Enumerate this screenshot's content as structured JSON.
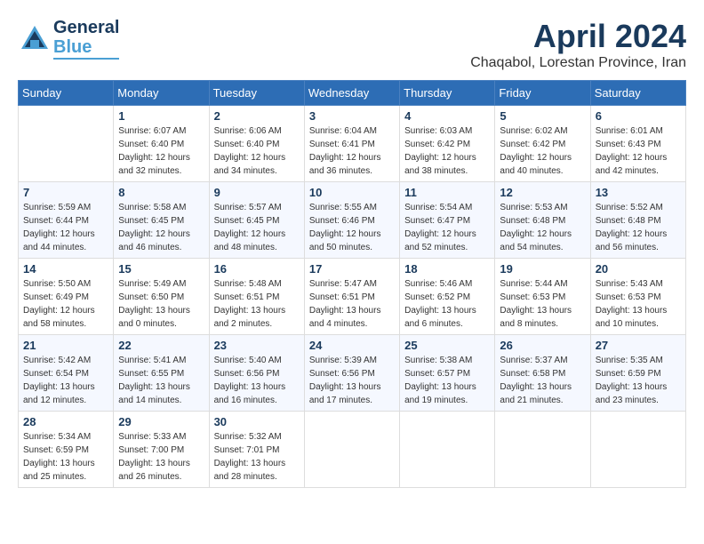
{
  "logo": {
    "line1": "General",
    "line2": "Blue"
  },
  "title": "April 2024",
  "location": "Chaqabol, Lorestan Province, Iran",
  "days_header": [
    "Sunday",
    "Monday",
    "Tuesday",
    "Wednesday",
    "Thursday",
    "Friday",
    "Saturday"
  ],
  "weeks": [
    [
      {
        "num": "",
        "sunrise": "",
        "sunset": "",
        "daylight": ""
      },
      {
        "num": "1",
        "sunrise": "Sunrise: 6:07 AM",
        "sunset": "Sunset: 6:40 PM",
        "daylight": "Daylight: 12 hours and 32 minutes."
      },
      {
        "num": "2",
        "sunrise": "Sunrise: 6:06 AM",
        "sunset": "Sunset: 6:40 PM",
        "daylight": "Daylight: 12 hours and 34 minutes."
      },
      {
        "num": "3",
        "sunrise": "Sunrise: 6:04 AM",
        "sunset": "Sunset: 6:41 PM",
        "daylight": "Daylight: 12 hours and 36 minutes."
      },
      {
        "num": "4",
        "sunrise": "Sunrise: 6:03 AM",
        "sunset": "Sunset: 6:42 PM",
        "daylight": "Daylight: 12 hours and 38 minutes."
      },
      {
        "num": "5",
        "sunrise": "Sunrise: 6:02 AM",
        "sunset": "Sunset: 6:42 PM",
        "daylight": "Daylight: 12 hours and 40 minutes."
      },
      {
        "num": "6",
        "sunrise": "Sunrise: 6:01 AM",
        "sunset": "Sunset: 6:43 PM",
        "daylight": "Daylight: 12 hours and 42 minutes."
      }
    ],
    [
      {
        "num": "7",
        "sunrise": "Sunrise: 5:59 AM",
        "sunset": "Sunset: 6:44 PM",
        "daylight": "Daylight: 12 hours and 44 minutes."
      },
      {
        "num": "8",
        "sunrise": "Sunrise: 5:58 AM",
        "sunset": "Sunset: 6:45 PM",
        "daylight": "Daylight: 12 hours and 46 minutes."
      },
      {
        "num": "9",
        "sunrise": "Sunrise: 5:57 AM",
        "sunset": "Sunset: 6:45 PM",
        "daylight": "Daylight: 12 hours and 48 minutes."
      },
      {
        "num": "10",
        "sunrise": "Sunrise: 5:55 AM",
        "sunset": "Sunset: 6:46 PM",
        "daylight": "Daylight: 12 hours and 50 minutes."
      },
      {
        "num": "11",
        "sunrise": "Sunrise: 5:54 AM",
        "sunset": "Sunset: 6:47 PM",
        "daylight": "Daylight: 12 hours and 52 minutes."
      },
      {
        "num": "12",
        "sunrise": "Sunrise: 5:53 AM",
        "sunset": "Sunset: 6:48 PM",
        "daylight": "Daylight: 12 hours and 54 minutes."
      },
      {
        "num": "13",
        "sunrise": "Sunrise: 5:52 AM",
        "sunset": "Sunset: 6:48 PM",
        "daylight": "Daylight: 12 hours and 56 minutes."
      }
    ],
    [
      {
        "num": "14",
        "sunrise": "Sunrise: 5:50 AM",
        "sunset": "Sunset: 6:49 PM",
        "daylight": "Daylight: 12 hours and 58 minutes."
      },
      {
        "num": "15",
        "sunrise": "Sunrise: 5:49 AM",
        "sunset": "Sunset: 6:50 PM",
        "daylight": "Daylight: 13 hours and 0 minutes."
      },
      {
        "num": "16",
        "sunrise": "Sunrise: 5:48 AM",
        "sunset": "Sunset: 6:51 PM",
        "daylight": "Daylight: 13 hours and 2 minutes."
      },
      {
        "num": "17",
        "sunrise": "Sunrise: 5:47 AM",
        "sunset": "Sunset: 6:51 PM",
        "daylight": "Daylight: 13 hours and 4 minutes."
      },
      {
        "num": "18",
        "sunrise": "Sunrise: 5:46 AM",
        "sunset": "Sunset: 6:52 PM",
        "daylight": "Daylight: 13 hours and 6 minutes."
      },
      {
        "num": "19",
        "sunrise": "Sunrise: 5:44 AM",
        "sunset": "Sunset: 6:53 PM",
        "daylight": "Daylight: 13 hours and 8 minutes."
      },
      {
        "num": "20",
        "sunrise": "Sunrise: 5:43 AM",
        "sunset": "Sunset: 6:53 PM",
        "daylight": "Daylight: 13 hours and 10 minutes."
      }
    ],
    [
      {
        "num": "21",
        "sunrise": "Sunrise: 5:42 AM",
        "sunset": "Sunset: 6:54 PM",
        "daylight": "Daylight: 13 hours and 12 minutes."
      },
      {
        "num": "22",
        "sunrise": "Sunrise: 5:41 AM",
        "sunset": "Sunset: 6:55 PM",
        "daylight": "Daylight: 13 hours and 14 minutes."
      },
      {
        "num": "23",
        "sunrise": "Sunrise: 5:40 AM",
        "sunset": "Sunset: 6:56 PM",
        "daylight": "Daylight: 13 hours and 16 minutes."
      },
      {
        "num": "24",
        "sunrise": "Sunrise: 5:39 AM",
        "sunset": "Sunset: 6:56 PM",
        "daylight": "Daylight: 13 hours and 17 minutes."
      },
      {
        "num": "25",
        "sunrise": "Sunrise: 5:38 AM",
        "sunset": "Sunset: 6:57 PM",
        "daylight": "Daylight: 13 hours and 19 minutes."
      },
      {
        "num": "26",
        "sunrise": "Sunrise: 5:37 AM",
        "sunset": "Sunset: 6:58 PM",
        "daylight": "Daylight: 13 hours and 21 minutes."
      },
      {
        "num": "27",
        "sunrise": "Sunrise: 5:35 AM",
        "sunset": "Sunset: 6:59 PM",
        "daylight": "Daylight: 13 hours and 23 minutes."
      }
    ],
    [
      {
        "num": "28",
        "sunrise": "Sunrise: 5:34 AM",
        "sunset": "Sunset: 6:59 PM",
        "daylight": "Daylight: 13 hours and 25 minutes."
      },
      {
        "num": "29",
        "sunrise": "Sunrise: 5:33 AM",
        "sunset": "Sunset: 7:00 PM",
        "daylight": "Daylight: 13 hours and 26 minutes."
      },
      {
        "num": "30",
        "sunrise": "Sunrise: 5:32 AM",
        "sunset": "Sunset: 7:01 PM",
        "daylight": "Daylight: 13 hours and 28 minutes."
      },
      {
        "num": "",
        "sunrise": "",
        "sunset": "",
        "daylight": ""
      },
      {
        "num": "",
        "sunrise": "",
        "sunset": "",
        "daylight": ""
      },
      {
        "num": "",
        "sunrise": "",
        "sunset": "",
        "daylight": ""
      },
      {
        "num": "",
        "sunrise": "",
        "sunset": "",
        "daylight": ""
      }
    ]
  ]
}
